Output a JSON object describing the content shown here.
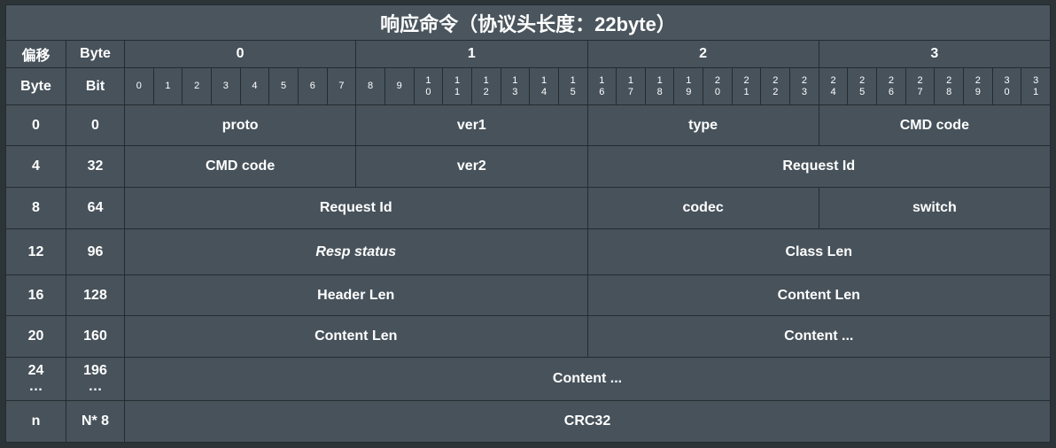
{
  "title": "响应命令（协议头长度：22byte）",
  "header": {
    "offset_label": "偏移",
    "byte_label": "Byte",
    "byte_cols": [
      "0",
      "1",
      "2",
      "3"
    ],
    "byte_col_label": "Byte",
    "bit_col_label": "Bit",
    "bits": [
      "0",
      "1",
      "2",
      "3",
      "4",
      "5",
      "6",
      "7",
      "8",
      "9",
      "1\n0",
      "1\n1",
      "1\n2",
      "1\n3",
      "1\n4",
      "1\n5",
      "1\n6",
      "1\n7",
      "1\n8",
      "1\n9",
      "2\n0",
      "2\n1",
      "2\n2",
      "2\n3",
      "2\n4",
      "2\n5",
      "2\n6",
      "2\n7",
      "2\n8",
      "2\n9",
      "3\n0",
      "3\n1"
    ]
  },
  "rows": [
    {
      "byte": "0",
      "bit": "0",
      "fields": [
        {
          "name": "proto",
          "span": 8
        },
        {
          "name": "ver1",
          "span": 8
        },
        {
          "name": "type",
          "span": 8
        },
        {
          "name": "CMD code",
          "span": 8
        }
      ]
    },
    {
      "byte": "4",
      "bit": "32",
      "fields": [
        {
          "name": "CMD code",
          "span": 8
        },
        {
          "name": "ver2",
          "span": 8
        },
        {
          "name": "Request Id",
          "span": 16
        }
      ]
    },
    {
      "byte": "8",
      "bit": "64",
      "fields": [
        {
          "name": "Request Id",
          "span": 16
        },
        {
          "name": "codec",
          "span": 8
        },
        {
          "name": "switch",
          "span": 8
        }
      ]
    },
    {
      "byte": "12",
      "bit": "96",
      "fields": [
        {
          "name": "Resp status",
          "span": 16,
          "italic": true
        },
        {
          "name": "Class Len",
          "span": 16
        }
      ]
    },
    {
      "byte": "16",
      "bit": "128",
      "fields": [
        {
          "name": "Header Len",
          "span": 16
        },
        {
          "name": "Content Len",
          "span": 16
        }
      ]
    },
    {
      "byte": "20",
      "bit": "160",
      "fields": [
        {
          "name": "Content Len",
          "span": 16
        },
        {
          "name": "Content ...",
          "span": 16
        }
      ]
    },
    {
      "byte": "24\n…",
      "bit": "196\n…",
      "fields": [
        {
          "name": "Content ...",
          "span": 32
        }
      ]
    },
    {
      "byte": "n",
      "bit": "N* 8",
      "fields": [
        {
          "name": "CRC32",
          "span": 32
        }
      ]
    }
  ]
}
